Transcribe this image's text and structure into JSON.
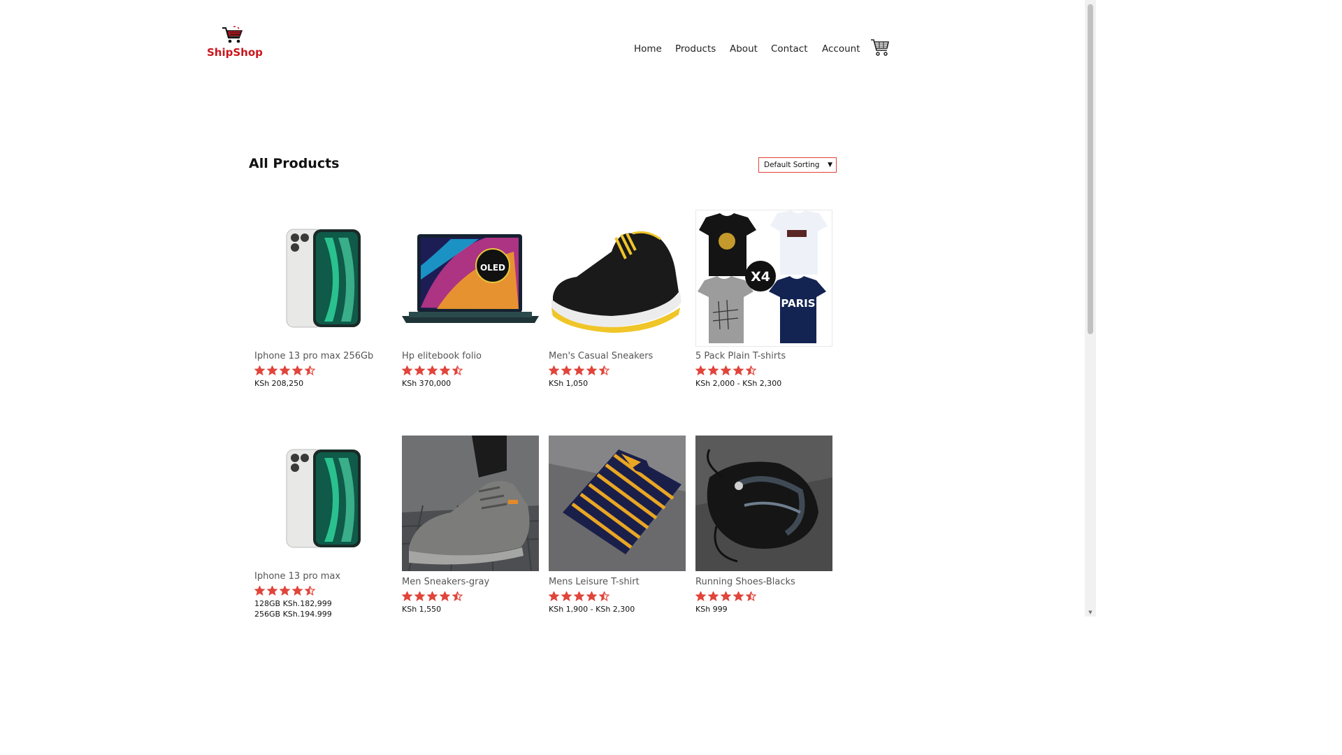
{
  "brand": {
    "name": "ShipShop",
    "color": "#c8161d"
  },
  "nav": {
    "home": "Home",
    "products": "Products",
    "about": "About",
    "contact": "Contact",
    "account": "Account",
    "cart_icon": "cart-icon"
  },
  "page": {
    "title": "All Products"
  },
  "sort": {
    "selected": "Default Sorting"
  },
  "accent": "#e0443a",
  "products": [
    {
      "name": "Iphone 13 pro max 256Gb",
      "rating": 4.5,
      "price": "KSh 208,250",
      "image": "phone-image"
    },
    {
      "name": "Hp elitebook folio",
      "rating": 4.5,
      "price": "KSh 370,000",
      "image": "laptop-image"
    },
    {
      "name": "Men's Casual Sneakers",
      "rating": 4.5,
      "price": "KSh 1,050",
      "image": "sneaker-image"
    },
    {
      "name": "5 Pack Plain T-shirts",
      "rating": 4.5,
      "price": "KSh 2,000 - KSh 2,300",
      "image": "tshirts-image",
      "badge": "X4"
    },
    {
      "name": "Iphone 13 pro max",
      "rating": 4.5,
      "price": "128GB KSh.182,999",
      "price2": "256GB KSh.194,999",
      "image": "phone-image"
    },
    {
      "name": "Men Sneakers-gray",
      "rating": 4.5,
      "price": "KSh 1,550",
      "image": "gray-sneaker-image"
    },
    {
      "name": "Mens Leisure T-shirt",
      "rating": 4.5,
      "price": "KSh 1,900 - KSh 2,300",
      "image": "striped-shirt-image"
    },
    {
      "name": "Running Shoes-Blacks",
      "rating": 4.5,
      "price": "KSh 999",
      "image": "black-shoes-image"
    }
  ]
}
